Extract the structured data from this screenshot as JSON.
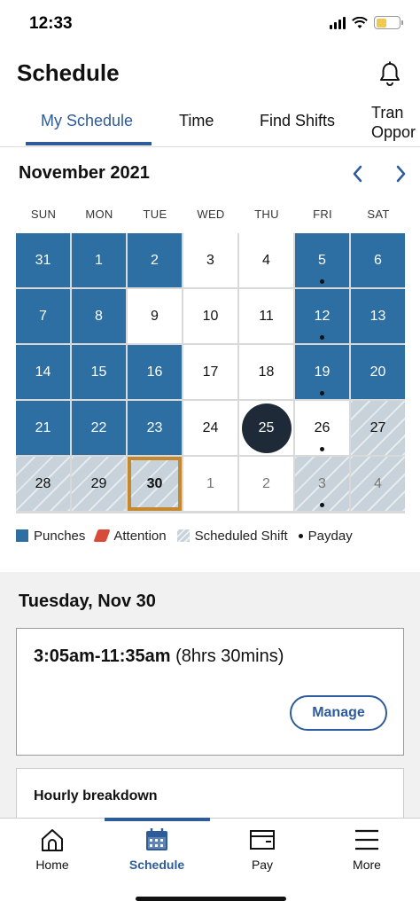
{
  "status_bar": {
    "time": "12:33",
    "battery_color": "#f2c94c"
  },
  "header": {
    "title": "Schedule",
    "notifications_icon": "bell-icon"
  },
  "tabs": [
    {
      "label": "My Schedule",
      "active": true
    },
    {
      "label": "Time",
      "active": false
    },
    {
      "label": "Find Shifts",
      "active": false
    },
    {
      "label": "Tran\nOppor",
      "active": false
    }
  ],
  "calendar": {
    "month": "November 2021",
    "prev_icon": "chevron-left-icon",
    "next_icon": "chevron-right-icon",
    "weekdays": [
      "SUN",
      "MON",
      "TUE",
      "WED",
      "THU",
      "FRI",
      "SAT"
    ],
    "weeks": [
      [
        {
          "day": "31",
          "type": "punch",
          "payday": false
        },
        {
          "day": "1",
          "type": "punch",
          "payday": false
        },
        {
          "day": "2",
          "type": "punch",
          "payday": false
        },
        {
          "day": "3",
          "type": "plain",
          "payday": false
        },
        {
          "day": "4",
          "type": "plain",
          "payday": false
        },
        {
          "day": "5",
          "type": "punch",
          "payday": true
        },
        {
          "day": "6",
          "type": "punch",
          "payday": false
        }
      ],
      [
        {
          "day": "7",
          "type": "punch",
          "payday": false
        },
        {
          "day": "8",
          "type": "punch",
          "payday": false
        },
        {
          "day": "9",
          "type": "plain",
          "payday": false
        },
        {
          "day": "10",
          "type": "plain",
          "payday": false
        },
        {
          "day": "11",
          "type": "plain",
          "payday": false
        },
        {
          "day": "12",
          "type": "punch",
          "payday": true
        },
        {
          "day": "13",
          "type": "punch",
          "payday": false
        }
      ],
      [
        {
          "day": "14",
          "type": "punch",
          "payday": false
        },
        {
          "day": "15",
          "type": "punch",
          "payday": false
        },
        {
          "day": "16",
          "type": "punch",
          "payday": false
        },
        {
          "day": "17",
          "type": "plain",
          "payday": false
        },
        {
          "day": "18",
          "type": "plain",
          "payday": false
        },
        {
          "day": "19",
          "type": "punch",
          "payday": true
        },
        {
          "day": "20",
          "type": "punch",
          "payday": false
        }
      ],
      [
        {
          "day": "21",
          "type": "punch",
          "payday": false
        },
        {
          "day": "22",
          "type": "punch",
          "payday": false
        },
        {
          "day": "23",
          "type": "punch",
          "payday": false
        },
        {
          "day": "24",
          "type": "plain",
          "payday": false
        },
        {
          "day": "25",
          "type": "today",
          "payday": false
        },
        {
          "day": "26",
          "type": "plain",
          "payday": true
        },
        {
          "day": "27",
          "type": "sched",
          "payday": false
        }
      ],
      [
        {
          "day": "28",
          "type": "sched",
          "payday": false
        },
        {
          "day": "29",
          "type": "sched",
          "payday": false
        },
        {
          "day": "30",
          "type": "selected",
          "payday": false
        },
        {
          "day": "1",
          "type": "faded",
          "payday": false
        },
        {
          "day": "2",
          "type": "faded",
          "payday": false
        },
        {
          "day": "3",
          "type": "sched-faded",
          "payday": true
        },
        {
          "day": "4",
          "type": "sched-faded",
          "payday": false
        }
      ]
    ],
    "colors": {
      "punch": "#2d6ea3",
      "scheduled": "#c7d2da",
      "today": "#1f2a38",
      "selected_border": "#c4882f"
    }
  },
  "legend": [
    {
      "label": "Punches",
      "swatch": "punch"
    },
    {
      "label": "Attention",
      "swatch": "attention"
    },
    {
      "label": "Scheduled Shift",
      "swatch": "sched"
    },
    {
      "label": "Payday",
      "swatch": "dot"
    }
  ],
  "selected_day": {
    "heading": "Tuesday, Nov 30",
    "shift_time": "3:05am-11:35am",
    "shift_duration": "(8hrs 30mins)",
    "manage_label": "Manage",
    "breakdown_title": "Hourly breakdown"
  },
  "bottom_nav": [
    {
      "label": "Home",
      "icon": "home-icon",
      "active": false
    },
    {
      "label": "Schedule",
      "icon": "calendar-icon",
      "active": true
    },
    {
      "label": "Pay",
      "icon": "wallet-icon",
      "active": false
    },
    {
      "label": "More",
      "icon": "menu-icon",
      "active": false
    }
  ],
  "accent_color": "#2e5b9a"
}
